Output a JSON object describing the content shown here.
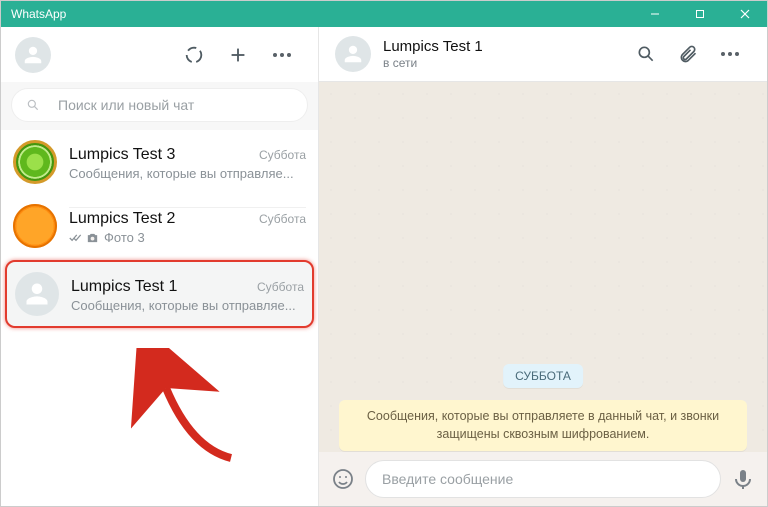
{
  "window": {
    "title": "WhatsApp"
  },
  "search": {
    "placeholder": "Поиск или новый чат"
  },
  "chats": [
    {
      "name": "Lumpics Test 3",
      "time": "Суббота",
      "preview": "Сообщения, которые вы отправляе..."
    },
    {
      "name": "Lumpics Test 2",
      "time": "Суббота",
      "preview": "Фото 3"
    },
    {
      "name": "Lumpics Test 1",
      "time": "Суббота",
      "preview": "Сообщения, которые вы отправляе..."
    }
  ],
  "conversation": {
    "name": "Lumpics Test 1",
    "status": "в сети",
    "day_label": "СУББОТА",
    "encryption_notice": "Сообщения, которые вы отправляете в данный чат, и звонки защищены сквозным шифрованием."
  },
  "composer": {
    "placeholder": "Введите сообщение"
  }
}
